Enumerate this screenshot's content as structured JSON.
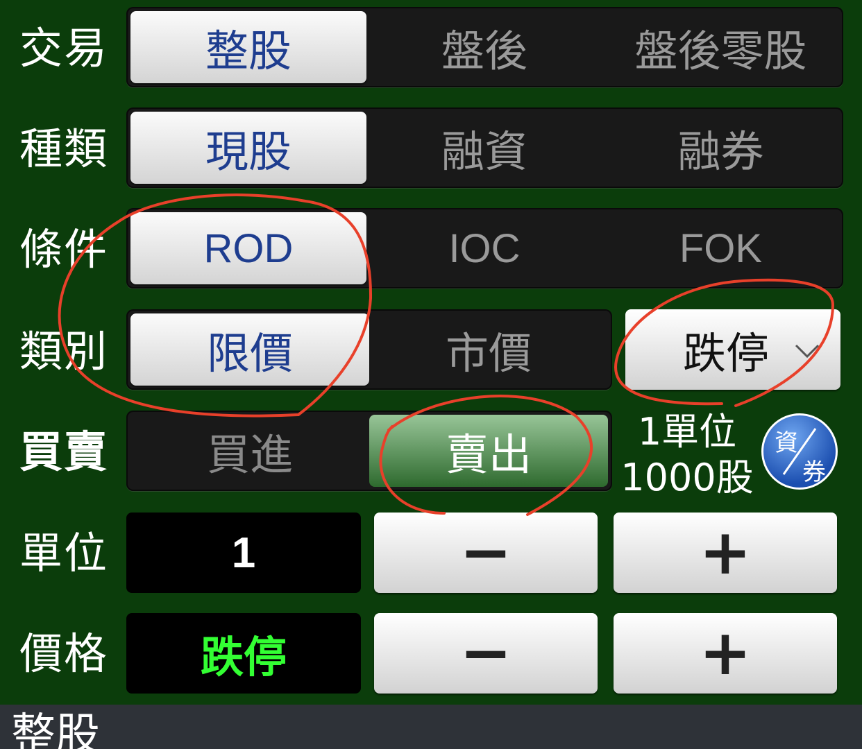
{
  "rows": {
    "trade": {
      "label": "交易",
      "options": [
        "整股",
        "盤後",
        "盤後零股"
      ],
      "selected": 0
    },
    "type": {
      "label": "種類",
      "options": [
        "現股",
        "融資",
        "融券"
      ],
      "selected": 0
    },
    "condition": {
      "label": "條件",
      "options": [
        "ROD",
        "IOC",
        "FOK"
      ],
      "selected": 0
    },
    "category": {
      "label": "類別",
      "options": [
        "限價",
        "市價"
      ],
      "selected": 0,
      "dropdown_value": "跌停"
    },
    "side": {
      "label": "買賣",
      "options": [
        "買進",
        "賣出"
      ],
      "selected": 1
    },
    "unit": {
      "label": "單位",
      "value": "1",
      "minus": "−",
      "plus": "+"
    },
    "price": {
      "label": "價格",
      "value": "跌停",
      "minus": "−",
      "plus": "+"
    }
  },
  "unit_info": {
    "line1": "1單位",
    "line2": "1000股"
  },
  "margin_badge": {
    "top": "資",
    "bottom": "券"
  },
  "bottom_bar": {
    "title": "整股"
  },
  "colors": {
    "background": "#0b3d0b",
    "selected_text": "#1e3d8f",
    "price_value": "#33ff33",
    "annotation": "#e8402a"
  }
}
